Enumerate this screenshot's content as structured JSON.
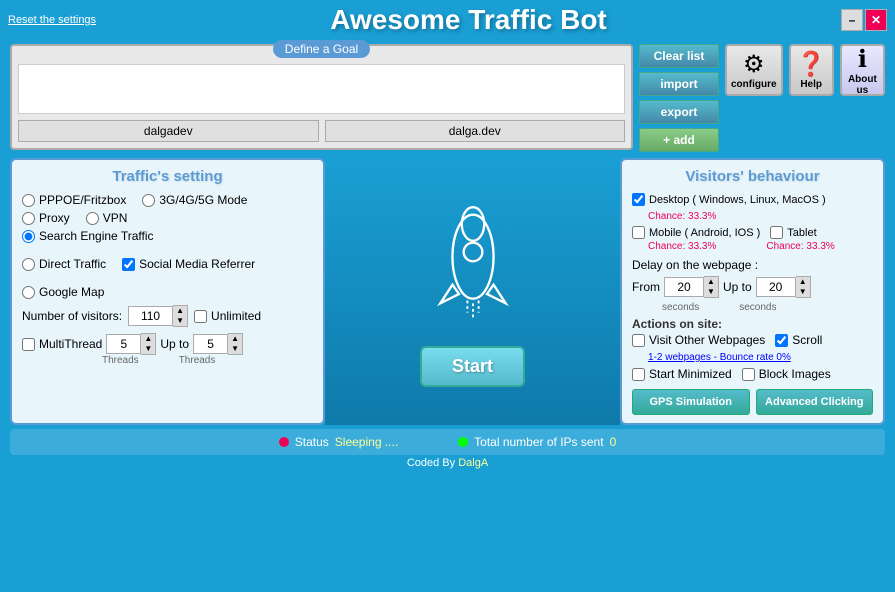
{
  "app": {
    "title": "Awesome Traffic Bot",
    "reset_label": "Reset the settings"
  },
  "window_controls": {
    "minimize": "–",
    "close": "✕"
  },
  "goal": {
    "title": "Define a Goal",
    "url1": "dalgadev",
    "url2": "dalga.dev"
  },
  "action_buttons": {
    "clear": "Clear list",
    "import": "import",
    "export": "export",
    "add": "+ add"
  },
  "config_buttons": {
    "configure_label": "configure",
    "help_label": "Help",
    "about_label": "About us"
  },
  "traffic_settings": {
    "title": "Traffic's setting",
    "options": {
      "pppoe": "PPPOE/Fritzbox",
      "mode_3g": "3G/4G/5G Mode",
      "proxy": "Proxy",
      "vpn": "VPN",
      "search_engine": "Search Engine Traffic",
      "direct": "Direct Traffic",
      "social_media": "Social Media Referrer",
      "google_map": "Google Map"
    },
    "visitors_label": "Number of visitors:",
    "visitors_value": "110",
    "unlimited_label": "Unlimited",
    "multithread_label": "MultiThread",
    "thread_value1": "5",
    "thread_upto": "Up to",
    "thread_value2": "5",
    "threads_label1": "Threads",
    "threads_label2": "Threads"
  },
  "visitors_behaviour": {
    "title": "Visitors' behaviour",
    "desktop_label": "Desktop ( Windows, Linux, MacOS )",
    "desktop_chance": "Chance: 33.3%",
    "mobile_label": "Mobile ( Android, IOS )",
    "mobile_chance": "Chance: 33.3%",
    "tablet_label": "Tablet",
    "tablet_chance": "Chance: 33.3%",
    "delay_label": "Delay on the webpage :",
    "from_label": "From",
    "delay_from": "20",
    "upto_label": "Up to",
    "delay_to": "20",
    "seconds1": "seconds",
    "seconds2": "seconds",
    "actions_label": "Actions on site:",
    "visit_pages_label": "Visit Other Webpages",
    "scroll_label": "Scroll",
    "bounce_link": "1-2 webpages - Bounce rate 0%",
    "start_minimized": "Start Minimized",
    "block_images": "Block Images",
    "gps_btn": "GPS Simulation",
    "advanced_clicking_btn": "Advanced Clicking"
  },
  "start_button": "Start",
  "status": {
    "status_label": "Status",
    "sleeping_label": "Sleeping ....",
    "total_ips_label": "Total number of IPs sent",
    "ips_value": "0"
  },
  "footer": {
    "coded_by": "Coded By ",
    "author": "DalgA"
  }
}
